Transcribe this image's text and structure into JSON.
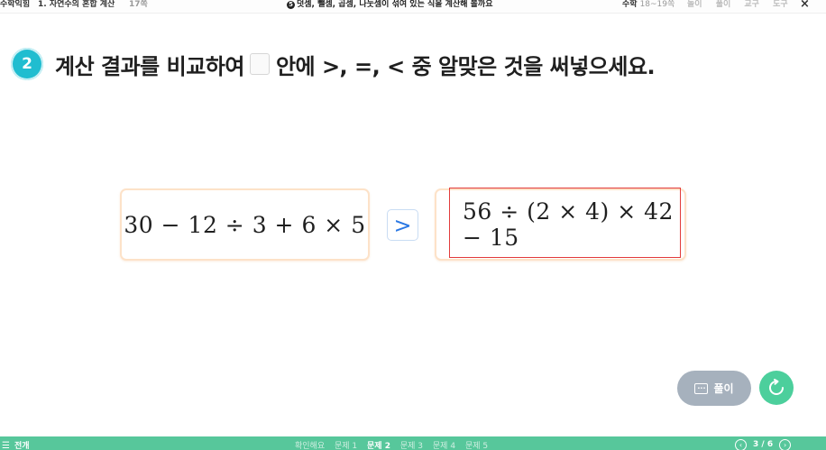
{
  "topbar": {
    "book": "수학익힘",
    "unit": "1. 자연수의 혼합 계산",
    "unit_pages": "17쪽",
    "lesson_number": "5",
    "lesson_title": "덧셈, 뺄셈, 곱셈, 나눗셈이 섞여 있는 식을 계산해 볼까요",
    "subject": "수학",
    "subject_pages": "18~19쪽",
    "menu": [
      "놀이",
      "풀이",
      "교구",
      "도구"
    ],
    "close": "×"
  },
  "question": {
    "number": "2",
    "text_before": "계산 결과를 비교하여",
    "text_after": "안에 >, =, < 중 알맞은 것을 써넣으세요."
  },
  "problem": {
    "left_expression": "30 − 12 ÷ 3 + 6 × 5",
    "answer": ">",
    "right_expression": "56 ÷ (2 × 4) × 42 − 15"
  },
  "buttons": {
    "solve_label": "풀이",
    "solve_icon": "speech-bubble-icon",
    "reset_icon": "refresh-icon"
  },
  "bottombar": {
    "all_label": "전개",
    "tabs": [
      "확인해요",
      "문제 1",
      "문제 2",
      "문제 3",
      "문제 4",
      "문제 5"
    ],
    "active_tab": "문제 2",
    "page_current": "3",
    "page_separator": "/",
    "page_total": "6"
  },
  "colors": {
    "accent_cyan": "#20bdd0",
    "answer_blue": "#2a78e4",
    "highlight_red": "#e23b3b",
    "card_border": "#fde2c8",
    "bottombar_green": "#57c79b",
    "reset_green": "#4ccf9c",
    "solve_gray": "#a6b1bd"
  }
}
